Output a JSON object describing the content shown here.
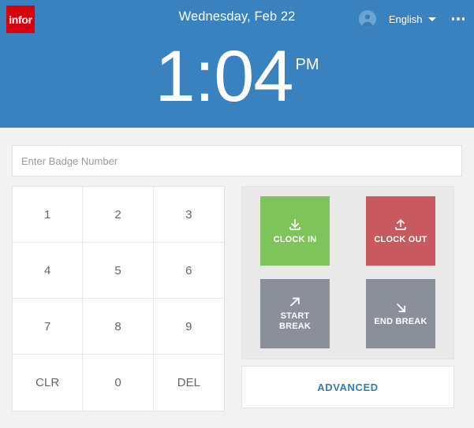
{
  "header": {
    "logo_text": "infor",
    "date_title": "Wednesday, Feb 22",
    "avatar_icon": "user-circle-icon",
    "language_label": "English",
    "caret_icon": "chevron-down-icon",
    "overflow_icon": "ellipsis-icon",
    "clock": {
      "time": "1:04",
      "meridiem": "PM"
    },
    "accent_color": "#3a82bf",
    "logo_color": "#d9000d"
  },
  "badge": {
    "value": "",
    "placeholder": "Enter Badge Number"
  },
  "keypad": {
    "keys": [
      {
        "label": "1",
        "name": "key-1"
      },
      {
        "label": "2",
        "name": "key-2"
      },
      {
        "label": "3",
        "name": "key-3"
      },
      {
        "label": "4",
        "name": "key-4"
      },
      {
        "label": "5",
        "name": "key-5"
      },
      {
        "label": "6",
        "name": "key-6"
      },
      {
        "label": "7",
        "name": "key-7"
      },
      {
        "label": "8",
        "name": "key-8"
      },
      {
        "label": "9",
        "name": "key-9"
      },
      {
        "label": "CLR",
        "name": "key-clear"
      },
      {
        "label": "0",
        "name": "key-0"
      },
      {
        "label": "DEL",
        "name": "key-delete"
      }
    ]
  },
  "actions": {
    "clock_in": {
      "label": "CLOCK IN",
      "icon": "download-arrow-icon",
      "color": "#7fc35b"
    },
    "clock_out": {
      "label": "CLOCK OUT",
      "icon": "upload-arrow-icon",
      "color": "#c8595e"
    },
    "start_break": {
      "label_line1": "START",
      "label_line2": "BREAK",
      "icon": "arrow-up-right-icon",
      "color": "#8b8f99"
    },
    "end_break": {
      "label": "END BREAK",
      "icon": "arrow-down-right-icon",
      "color": "#8b8f99"
    },
    "advanced_label": "ADVANCED",
    "advanced_color": "#2f7cbb"
  }
}
